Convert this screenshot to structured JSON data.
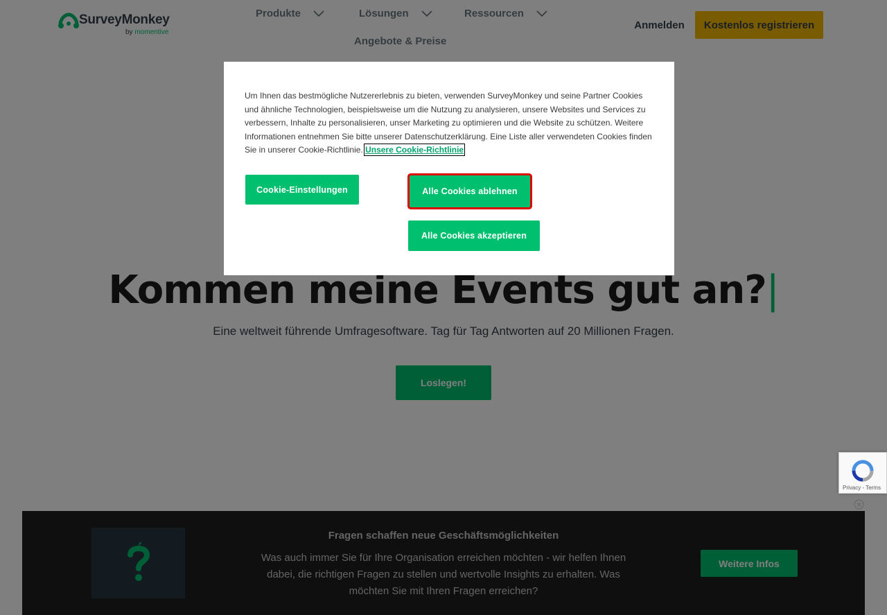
{
  "colors": {
    "brand_green": "#00bf6f",
    "register_yellow": "#f2b705",
    "reject_highlight": "#e00000",
    "banner_bg": "#1f1f1f"
  },
  "header": {
    "logo_text": "SurveyMonkey",
    "logo_sub_prefix": "by ",
    "logo_sub_brand": "momentive",
    "nav": [
      {
        "label": "Produkte",
        "icon": "chevron-down-icon"
      },
      {
        "label": "Lösungen",
        "icon": "chevron-down-icon"
      },
      {
        "label": "Ressourcen",
        "icon": "chevron-down-icon"
      },
      {
        "label": "Angebote & Preise"
      }
    ],
    "login_label": "Anmelden",
    "register_label": "Kostenlos registrieren"
  },
  "hero": {
    "title": "Kommen meine Events gut an?",
    "cursor": "|",
    "subtitle": "Eine weltweit führende Umfragesoftware. Tag für Tag Antworten auf 20 Millionen Fragen.",
    "cta_label": "Loslegen!"
  },
  "cookie_modal": {
    "text": "Um Ihnen das bestmögliche Nutzererlebnis zu bieten, verwenden SurveyMonkey und seine Partner Cookies und ähnliche Technologien, beispielsweise um die Nutzung zu analysieren, unsere Websites und Services zu verbessern, Inhalte zu personalisieren, unser Marketing zu optimieren und die Website zu schützen. Weitere Informationen entnehmen Sie bitte unserer Datenschutzerklärung. Eine Liste aller verwendeten Cookies finden Sie in unserer Cookie-Richtlinie. ",
    "policy_link": "Unsere Cookie-Richtlinie",
    "settings_label": "Cookie-Einstellungen",
    "reject_label": "Alle Cookies ablehnen",
    "accept_label": "Alle Cookies akzeptieren"
  },
  "recaptcha": {
    "terms": "Privacy - Terms"
  },
  "banner": {
    "title": "Fragen schaffen neue Geschäftsmöglichkeiten",
    "text": "Was auch immer Sie für Ihre Organisation erreichen möchten - wir helfen Ihnen dabei, die richtigen Fragen zu stellen und wertvolle Insights zu erhalten. Was möchten Sie mit Ihren Fragen erreichen?",
    "button_label": "Weitere Infos",
    "image_icon": "question-mark-icon"
  }
}
